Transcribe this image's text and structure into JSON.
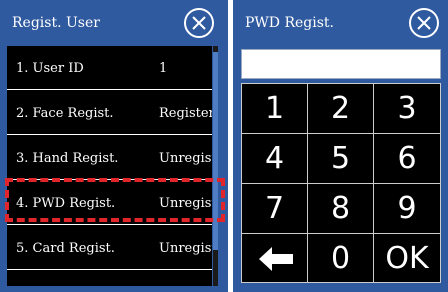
{
  "left_panel": {
    "title": "Regist. User",
    "items": [
      {
        "label": "1. User ID",
        "value": "1"
      },
      {
        "label": "2. Face Regist.",
        "value": "Register"
      },
      {
        "label": "3. Hand Regist.",
        "value": "Unregist"
      },
      {
        "label": "4. PWD Regist.",
        "value": "Unregist"
      },
      {
        "label": "5. Card Regist.",
        "value": "Unregist"
      }
    ],
    "highlighted_item": "4. PWD Regist."
  },
  "right_panel": {
    "title": "PWD Regist.",
    "password_value": "",
    "keys": [
      "1",
      "2",
      "3",
      "4",
      "5",
      "6",
      "7",
      "8",
      "9",
      "",
      "0",
      "OK"
    ],
    "back_key_icon": "left-arrow-icon"
  },
  "colors": {
    "panel_blue": "#2f5aa0",
    "list_black": "#000000",
    "highlight_red": "#e0262a",
    "text_white": "#ffffff"
  },
  "icons": {
    "close": "close-icon",
    "backspace": "left-arrow-icon"
  }
}
